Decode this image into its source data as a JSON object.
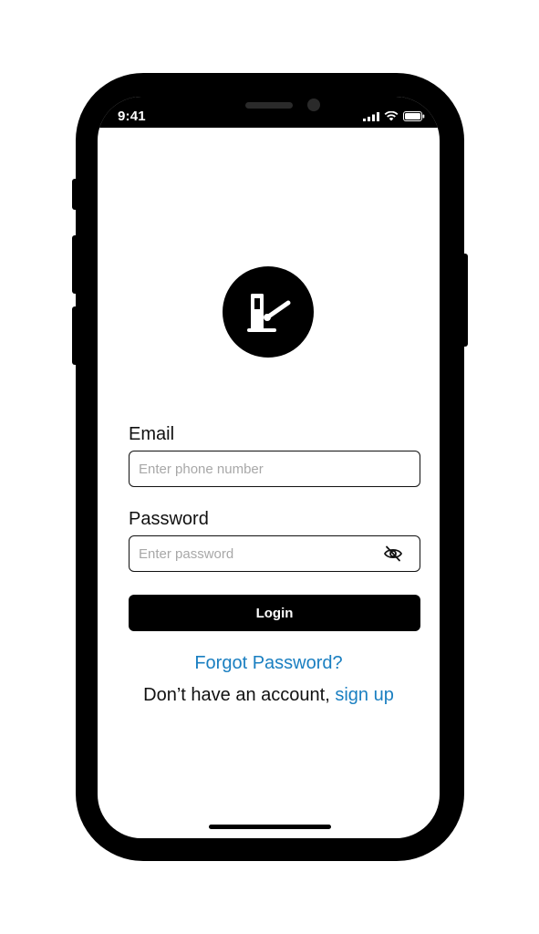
{
  "status_bar": {
    "time": "9:41"
  },
  "logo": {
    "icon": "parking-barrier-icon"
  },
  "email": {
    "label": "Email",
    "placeholder": "Enter phone number",
    "value": ""
  },
  "password": {
    "label": "Password",
    "placeholder": "Enter password",
    "value": "",
    "toggle_icon": "eye-off-icon"
  },
  "login_button": {
    "label": "Login"
  },
  "forgot_password": {
    "label": "Forgot Password?"
  },
  "signup": {
    "prompt": "Don’t have an account,",
    "link_label": "sign up"
  },
  "colors": {
    "accent": "#1a7fc1",
    "primary": "#000000",
    "placeholder": "#a8a8a8"
  }
}
